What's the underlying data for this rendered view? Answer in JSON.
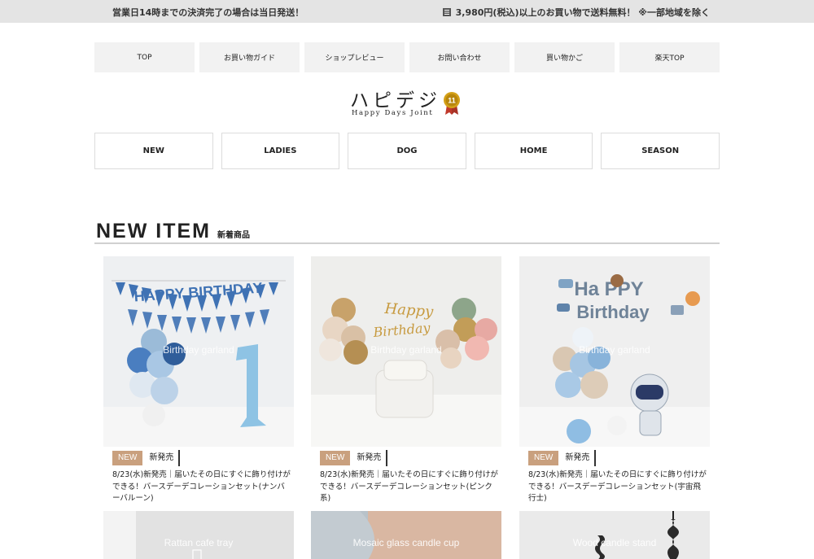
{
  "topbar": {
    "left_text": "営業日14時までの決済完了の場合は当日発送！",
    "right_text": "3,980円(税込)以上のお買い物で送料無料！ ※一部地域を除く"
  },
  "global_nav": {
    "items": [
      {
        "label": "TOP"
      },
      {
        "label": "お買い物ガイド"
      },
      {
        "label": "ショップレビュー"
      },
      {
        "label": "お問い合わせ"
      },
      {
        "label": "買い物かご"
      },
      {
        "label": "楽天TOP"
      }
    ]
  },
  "logo": {
    "jp": "ハピデジ",
    "en": "Happy Days Joint",
    "badge_number": "11"
  },
  "category_nav": {
    "items": [
      {
        "label": "NEW"
      },
      {
        "label": "LADIES"
      },
      {
        "label": "DOG"
      },
      {
        "label": "HOME"
      },
      {
        "label": "SEASON"
      }
    ]
  },
  "section": {
    "title_en": "NEW ITEM",
    "title_jp": "新着商品"
  },
  "products": [
    {
      "overlay": "Birthday garland",
      "badge": "NEW",
      "tag": "新発売",
      "description": "8/23(水)新発売｜届いたその日にすぐに飾り付けができる！バースデーデコレーションセット(ナンバーバルーン)"
    },
    {
      "overlay": "Birthday garland",
      "badge": "NEW",
      "tag": "新発売",
      "description": "8/23(水)新発売｜届いたその日にすぐに飾り付けができる！バースデーデコレーションセット(ピンク系)"
    },
    {
      "overlay": "Birthday garland",
      "badge": "NEW",
      "tag": "新発売",
      "description": "8/23(水)新発売｜届いたその日にすぐに飾り付けができる！バースデーデコレーションセット(宇宙飛行士)"
    }
  ],
  "partial_products": [
    {
      "overlay": "Rattan cafe tray"
    },
    {
      "overlay": "Mosaic glass candle cup"
    },
    {
      "overlay": "Wood candle stand"
    }
  ],
  "colors": {
    "topbar_bg": "#e4e4e4",
    "nav_bg": "#f2f2f2",
    "new_badge": "#c9a07e"
  }
}
